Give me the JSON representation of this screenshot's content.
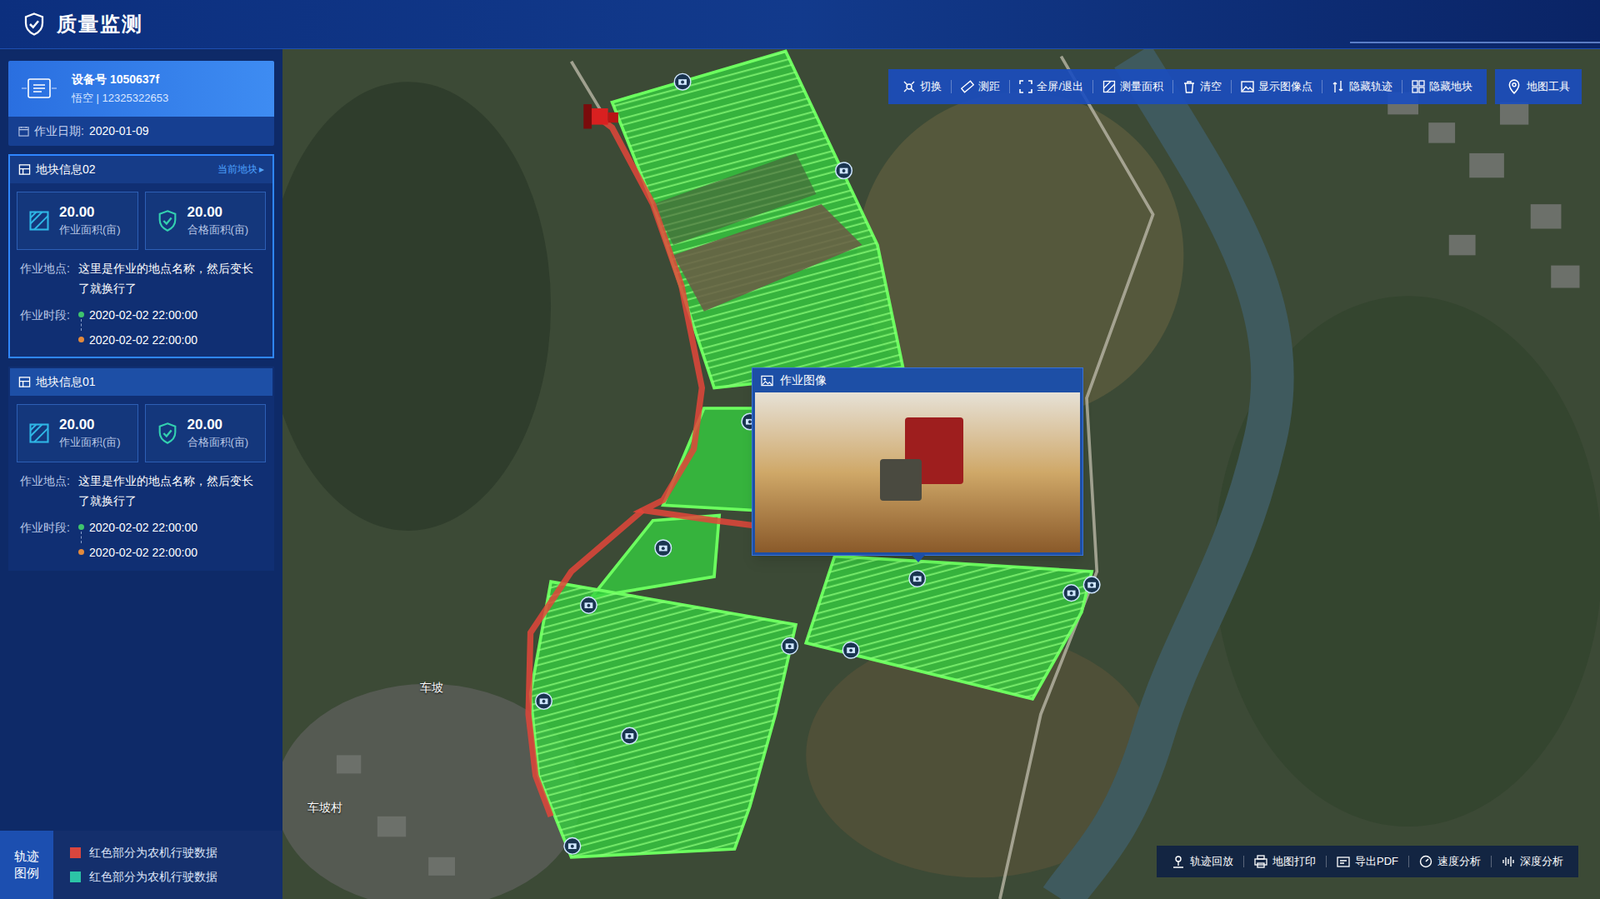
{
  "header": {
    "title": "质量监测"
  },
  "device": {
    "id": "设备号 1050637f",
    "info": "悟空 | 12325322653",
    "date_label": "作业日期:",
    "date": "2020-01-09"
  },
  "plots": [
    {
      "title": "地块信息02",
      "current": true,
      "current_label": "当前地块",
      "arrow": "▸",
      "stats": [
        {
          "value": "20.00",
          "label": "作业面积(亩)"
        },
        {
          "value": "20.00",
          "label": "合格面积(亩)"
        }
      ],
      "location_label": "作业地点:",
      "location": "这里是作业的地点名称，然后变长了就换行了",
      "period_label": "作业时段:",
      "times": [
        {
          "time": "2020-02-02 22:00:00",
          "color": "#3ec46d"
        },
        {
          "time": "2020-02-02 22:00:00",
          "color": "#e38a3c"
        }
      ]
    },
    {
      "title": "地块信息01",
      "current": false,
      "stats": [
        {
          "value": "20.00",
          "label": "作业面积(亩)"
        },
        {
          "value": "20.00",
          "label": "合格面积(亩)"
        }
      ],
      "location_label": "作业地点:",
      "location": "这里是作业的地点名称，然后变长了就换行了",
      "period_label": "作业时段:",
      "times": [
        {
          "time": "2020-02-02 22:00:00",
          "color": "#3ec46d"
        },
        {
          "time": "2020-02-02 22:00:00",
          "color": "#e38a3c"
        }
      ]
    }
  ],
  "legend": {
    "title": "轨迹图例",
    "items": [
      {
        "label": "红色部分为农机行驶数据",
        "color": "#d9463e"
      },
      {
        "label": "红色部分为农机行驶数据",
        "color": "#2cc4a6"
      }
    ]
  },
  "toolbar": [
    "切换",
    "测距",
    "全屏/退出",
    "测量面积",
    "清空",
    "显示图像点",
    "隐藏轨迹",
    "隐藏地块"
  ],
  "map_tool": "地图工具",
  "bottom_tools": [
    "轨迹回放",
    "地图打印",
    "导出PDF",
    "速度分析",
    "深度分析"
  ],
  "popup": {
    "title": "作业图像"
  },
  "map": {
    "labels": [
      "车坡",
      "车坡村"
    ]
  }
}
